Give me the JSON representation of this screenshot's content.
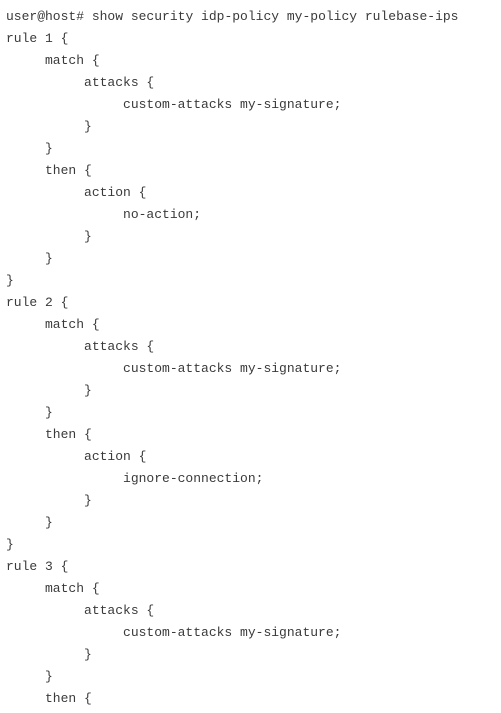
{
  "prompt": "user@host#",
  "command": "show security idp-policy my-policy rulebase-ips",
  "indent_unit": "     ",
  "rules": [
    {
      "name": "rule 1",
      "match": {
        "attacks": "custom-attacks my-signature;"
      },
      "then": {
        "action": "no-action;"
      },
      "then_closed": true,
      "rule_closed": true
    },
    {
      "name": "rule 2",
      "match": {
        "attacks": "custom-attacks my-signature;"
      },
      "then": {
        "action": "ignore-connection;"
      },
      "then_closed": true,
      "rule_closed": true
    },
    {
      "name": "rule 3",
      "match": {
        "attacks": "custom-attacks my-signature;"
      },
      "then": null,
      "then_closed": false,
      "rule_closed": false
    }
  ]
}
